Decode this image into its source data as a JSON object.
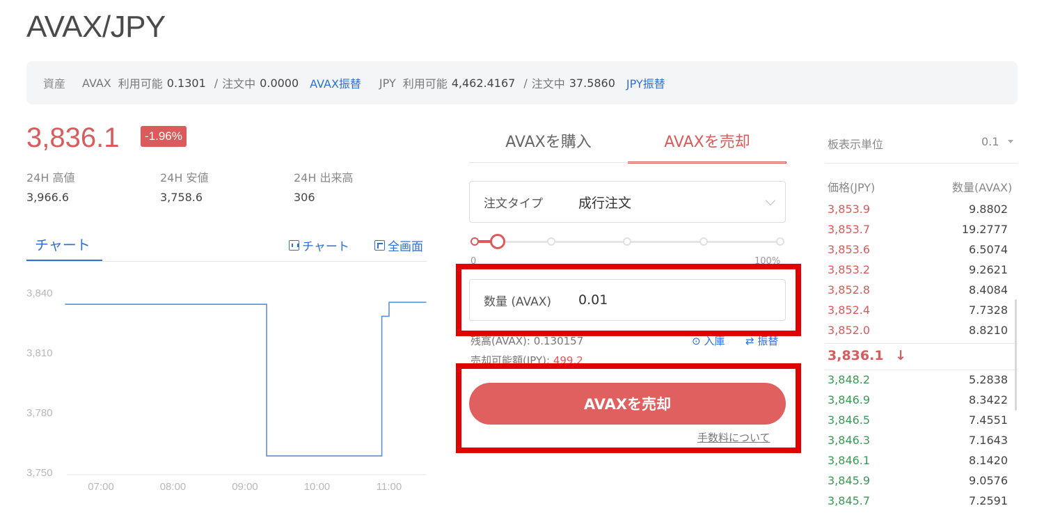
{
  "pair_title": "AVAX/JPY",
  "assets": {
    "label": "資産",
    "avax_currency": "AVAX",
    "avax_available_label": "利用可能",
    "avax_available": "0.1301",
    "avax_in_order_label": "注文中",
    "avax_in_order": "0.0000",
    "avax_transfer_link": "AVAX振替",
    "jpy_currency": "JPY",
    "jpy_available_label": "利用可能",
    "jpy_available": "4,462.4167",
    "jpy_in_order_label": "注文中",
    "jpy_in_order": "37.5860",
    "jpy_transfer_link": "JPY振替",
    "separator": "/"
  },
  "ticker": {
    "price": "3,836.1",
    "change": "-1.96%",
    "high_label": "24H 高値",
    "high": "3,966.6",
    "low_label": "24H 安値",
    "low": "3,758.6",
    "volume_label": "24H 出来高",
    "volume": "306"
  },
  "chart_panel": {
    "tab_label": "チャート",
    "chart_link": "チャート",
    "fullscreen_link": "全画面"
  },
  "chart_data": {
    "type": "line",
    "x_ticks": [
      "07:00",
      "08:00",
      "09:00",
      "10:00",
      "11:00"
    ],
    "y_ticks": [
      "3,840",
      "3,810",
      "3,780",
      "3,750"
    ],
    "ylim": [
      3750,
      3840
    ],
    "series": [
      {
        "color": "#5b8fd6",
        "step": true,
        "points": [
          [
            "06:30",
            3834
          ],
          [
            "09:18",
            3834
          ],
          [
            "09:18",
            3758
          ],
          [
            "10:54",
            3758
          ],
          [
            "10:54",
            3828
          ],
          [
            "11:00",
            3828
          ],
          [
            "11:00",
            3835
          ],
          [
            "11:31",
            3835
          ]
        ]
      }
    ]
  },
  "trade": {
    "buy_tab": "AVAXを購入",
    "sell_tab": "AVAXを売却",
    "order_type_label": "注文タイプ",
    "order_type_value": "成行注文",
    "slider_min": "0",
    "slider_max": "100%",
    "slider_value_percent": 7,
    "quantity_label": "数量 (AVAX)",
    "quantity_value": "0.01",
    "balance_label": "残高(AVAX):",
    "balance_value": "0.130157",
    "deposit_link": "入庫",
    "transfer_link": "振替",
    "sellable_label": "売却可能額(JPY):",
    "sellable_value": "499.2",
    "sell_button": "AVAXを売却",
    "fee_link": "手数料について"
  },
  "orderbook": {
    "unit_label": "板表示単位",
    "unit_value": "0.1",
    "price_header": "価格(JPY)",
    "qty_header": "数量(AVAX)",
    "asks": [
      {
        "price": "3,853.9",
        "qty": "9.8802"
      },
      {
        "price": "3,853.7",
        "qty": "19.2777"
      },
      {
        "price": "3,853.6",
        "qty": "6.5074"
      },
      {
        "price": "3,853.2",
        "qty": "9.2621"
      },
      {
        "price": "3,852.8",
        "qty": "8.4084"
      },
      {
        "price": "3,852.4",
        "qty": "7.7328"
      },
      {
        "price": "3,852.0",
        "qty": "8.8210"
      }
    ],
    "last_price": "3,836.1",
    "last_arrow": "↓",
    "bids": [
      {
        "price": "3,848.2",
        "qty": "5.2838"
      },
      {
        "price": "3,846.9",
        "qty": "8.3422"
      },
      {
        "price": "3,846.5",
        "qty": "7.4551"
      },
      {
        "price": "3,846.3",
        "qty": "7.1643"
      },
      {
        "price": "3,846.1",
        "qty": "8.1420"
      },
      {
        "price": "3,845.9",
        "qty": "9.0576"
      },
      {
        "price": "3,845.7",
        "qty": "7.2591"
      }
    ]
  },
  "colors": {
    "accent": "#2f6fd6",
    "sell": "#d95b5b",
    "buy": "#3a9a55",
    "highlight": "#e10000"
  }
}
